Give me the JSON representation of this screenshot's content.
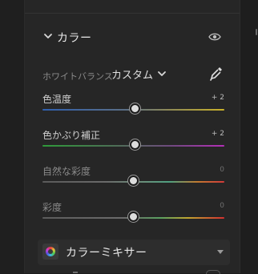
{
  "section": {
    "title": "カラー",
    "icons": {
      "collapse": "chevron-down-icon",
      "visibility": "eye-icon"
    }
  },
  "white_balance": {
    "label": "ホワイトバランス",
    "value": "カスタム",
    "icons": {
      "dropdown": "chevron-down-icon",
      "picker": "eyedropper-icon"
    }
  },
  "sliders": [
    {
      "label": "色温度",
      "value": "+ 2",
      "level": 0.51
    },
    {
      "label": "色かぶり補正",
      "value": "+ 2",
      "level": 0.51
    },
    {
      "label": "自然な彩度",
      "value": "0",
      "level": 0.5
    },
    {
      "label": "彩度",
      "value": "0",
      "level": 0.5
    }
  ],
  "mixer": {
    "title": "カラーミキサー",
    "icon": "color-wheel-icon"
  },
  "colors": {
    "panel": "#262626",
    "text": "#e0e0e0",
    "dim_text": "#8a8a8a"
  }
}
